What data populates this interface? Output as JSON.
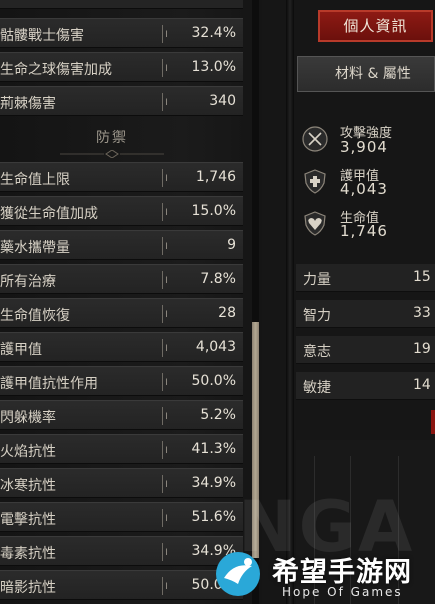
{
  "stats_panel": {
    "top_partial_value": "",
    "offense_rows": [
      {
        "label": "骷髏戰士傷害",
        "value": "32.4%"
      },
      {
        "label": "生命之球傷害加成",
        "value": "13.0%"
      },
      {
        "label": "荊棘傷害",
        "value": "340"
      }
    ],
    "defense_title": "防禦",
    "defense_rows": [
      {
        "label": "生命值上限",
        "value": "1,746"
      },
      {
        "label": "獲從生命值加成",
        "value": "15.0%"
      },
      {
        "label": "藥水攜帶量",
        "value": "9"
      },
      {
        "label": "所有治療",
        "value": "7.8%"
      },
      {
        "label": "生命值恢復",
        "value": "28"
      },
      {
        "label": "護甲值",
        "value": "4,043"
      },
      {
        "label": "護甲值抗性作用",
        "value": "50.0%"
      },
      {
        "label": "閃躲機率",
        "value": "5.2%"
      },
      {
        "label": "火焰抗性",
        "value": "41.3%"
      },
      {
        "label": "冰寒抗性",
        "value": "34.9%"
      },
      {
        "label": "電擊抗性",
        "value": "51.6%"
      },
      {
        "label": "毒素抗性",
        "value": "34.9%"
      },
      {
        "label": "暗影抗性",
        "value": "50.0%"
      }
    ]
  },
  "character_panel": {
    "profile_button": "個人資訊",
    "materials_tab": "材料 & 屬性",
    "key_stats": [
      {
        "name": "攻擊強度",
        "value": "3,904",
        "icon": "swords-icon"
      },
      {
        "name": "護甲值",
        "value": "4,043",
        "icon": "shield-icon"
      },
      {
        "name": "生命值",
        "value": "1,746",
        "icon": "heart-icon"
      }
    ],
    "attributes": [
      {
        "name": "力量",
        "value": "15"
      },
      {
        "name": "智力",
        "value": "33"
      },
      {
        "name": "意志",
        "value": "19"
      },
      {
        "name": "敏捷",
        "value": "14"
      }
    ]
  },
  "watermark": {
    "site_cn": "希望手游网",
    "site_en": "Hope Of Games",
    "nga": "NGA"
  },
  "colors": {
    "accent_red": "#8d1a14",
    "panel_dark": "#161616",
    "row_bg": "#262626"
  }
}
